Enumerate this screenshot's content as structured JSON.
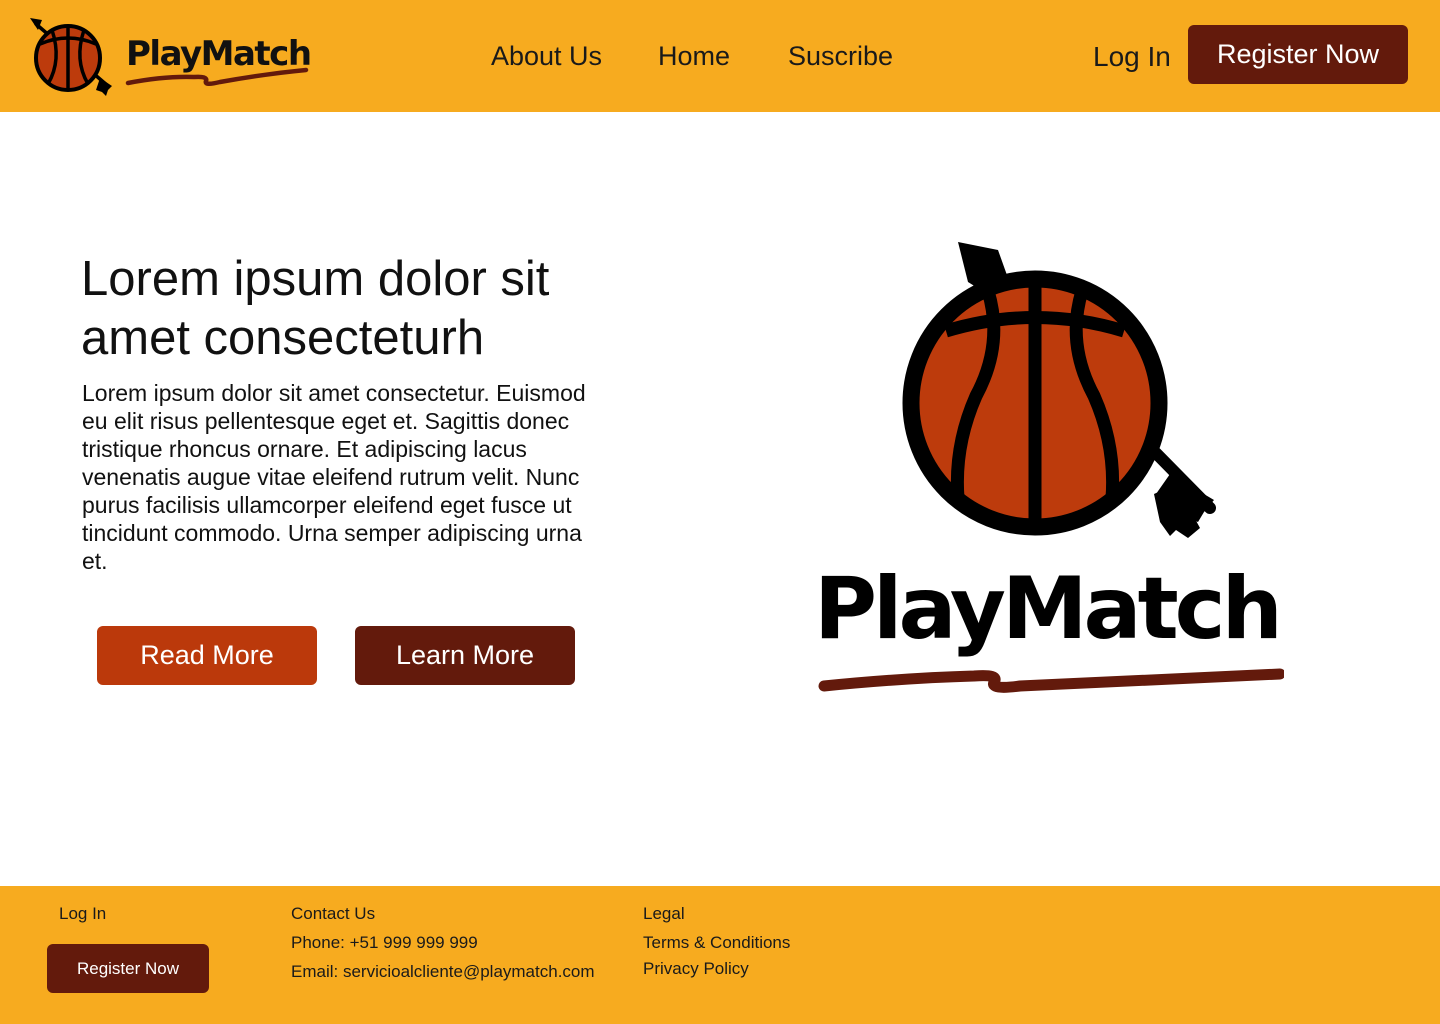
{
  "brand": {
    "name": "PlayMatch"
  },
  "colors": {
    "header_bg": "#f7ab1f",
    "primary_dark": "#631a0c",
    "accent_orange": "#bb390b",
    "ball_orange": "#bd3b0c"
  },
  "nav": {
    "items": [
      {
        "label": "About Us"
      },
      {
        "label": "Home"
      },
      {
        "label": "Suscribe"
      }
    ],
    "login_label": "Log In",
    "register_label": "Register Now"
  },
  "hero": {
    "title": "Lorem ipsum dolor sit amet consecteturh",
    "text": "Lorem ipsum dolor sit amet consectetur. Euismod eu elit risus pellentesque eget et. Sagittis donec tristique rhoncus ornare. Et adipiscing lacus venenatis augue vitae eleifend rutrum velit. Nunc purus facilisis ullamcorper eleifend eget fusce ut tincidunt commodo. Urna semper adipiscing urna et.",
    "read_more_label": "Read More",
    "learn_more_label": "Learn More",
    "logo_icon": "basketball-arrow-icon"
  },
  "footer": {
    "login_label": "Log In",
    "register_label": "Register Now",
    "contact_heading": "Contact Us",
    "phone": "Phone: +51 999 999 999",
    "email": "Email: servicioalcliente@playmatch.com",
    "legal_heading": "Legal",
    "terms_label": "Terms & Conditions",
    "privacy_label": "Privacy Policy"
  }
}
